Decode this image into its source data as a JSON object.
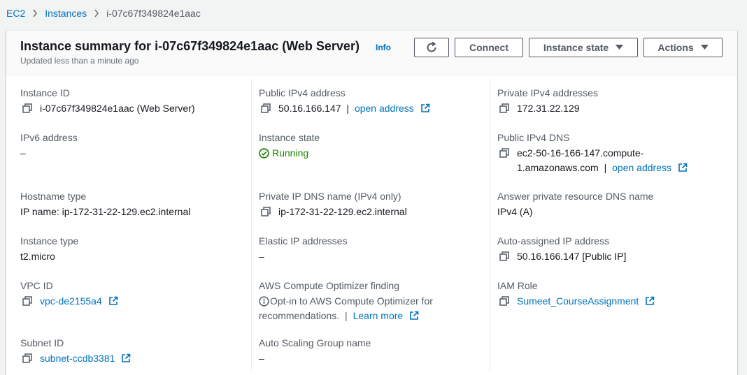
{
  "breadcrumb": {
    "items": [
      "EC2",
      "Instances"
    ],
    "current": "i-07c67f349824e1aac"
  },
  "header": {
    "title": "Instance summary for i-07c67f349824e1aac (Web Server)",
    "info": "Info",
    "subtitle": "Updated less than a minute ago",
    "buttons": {
      "connect": "Connect",
      "instance_state": "Instance state",
      "actions": "Actions"
    }
  },
  "fields": {
    "instance_id": {
      "label": "Instance ID",
      "value": "i-07c67f349824e1aac (Web Server)"
    },
    "public_ipv4": {
      "label": "Public IPv4 address",
      "value": "50.16.166.147",
      "link": "open address"
    },
    "private_ipv4": {
      "label": "Private IPv4 addresses",
      "value": "172.31.22.129"
    },
    "ipv6": {
      "label": "IPv6 address",
      "value": "–"
    },
    "instance_state": {
      "label": "Instance state",
      "value": "Running"
    },
    "public_dns": {
      "label": "Public IPv4 DNS",
      "value_line1": "ec2-50-16-166-147.compute-",
      "value_line2": "1.amazonaws.com",
      "link": "open address"
    },
    "hostname_type": {
      "label": "Hostname type",
      "value": "IP name: ip-172-31-22-129.ec2.internal"
    },
    "private_dns": {
      "label": "Private IP DNS name (IPv4 only)",
      "value": "ip-172-31-22-129.ec2.internal"
    },
    "answer_dns": {
      "label": "Answer private resource DNS name",
      "value": "IPv4 (A)"
    },
    "instance_type": {
      "label": "Instance type",
      "value": "t2.micro"
    },
    "elastic_ip": {
      "label": "Elastic IP addresses",
      "value": "–"
    },
    "auto_ip": {
      "label": "Auto-assigned IP address",
      "value": "50.16.166.147 [Public IP]"
    },
    "vpc_id": {
      "label": "VPC ID",
      "value": "vpc-de2155a4"
    },
    "optimizer": {
      "label": "AWS Compute Optimizer finding",
      "line1": "Opt-in to AWS Compute Optimizer for",
      "line2": "recommendations.",
      "link": "Learn more"
    },
    "iam_role": {
      "label": "IAM Role",
      "value": "Sumeet_CourseAssignment"
    },
    "subnet_id": {
      "label": "Subnet ID",
      "value": "subnet-ccdb3381"
    },
    "asg_name": {
      "label": "Auto Scaling Group name",
      "value": "–"
    }
  },
  "colors": {
    "link": "#0073bb",
    "running": "#1d8102",
    "label": "#545b64",
    "text": "#16191f"
  }
}
